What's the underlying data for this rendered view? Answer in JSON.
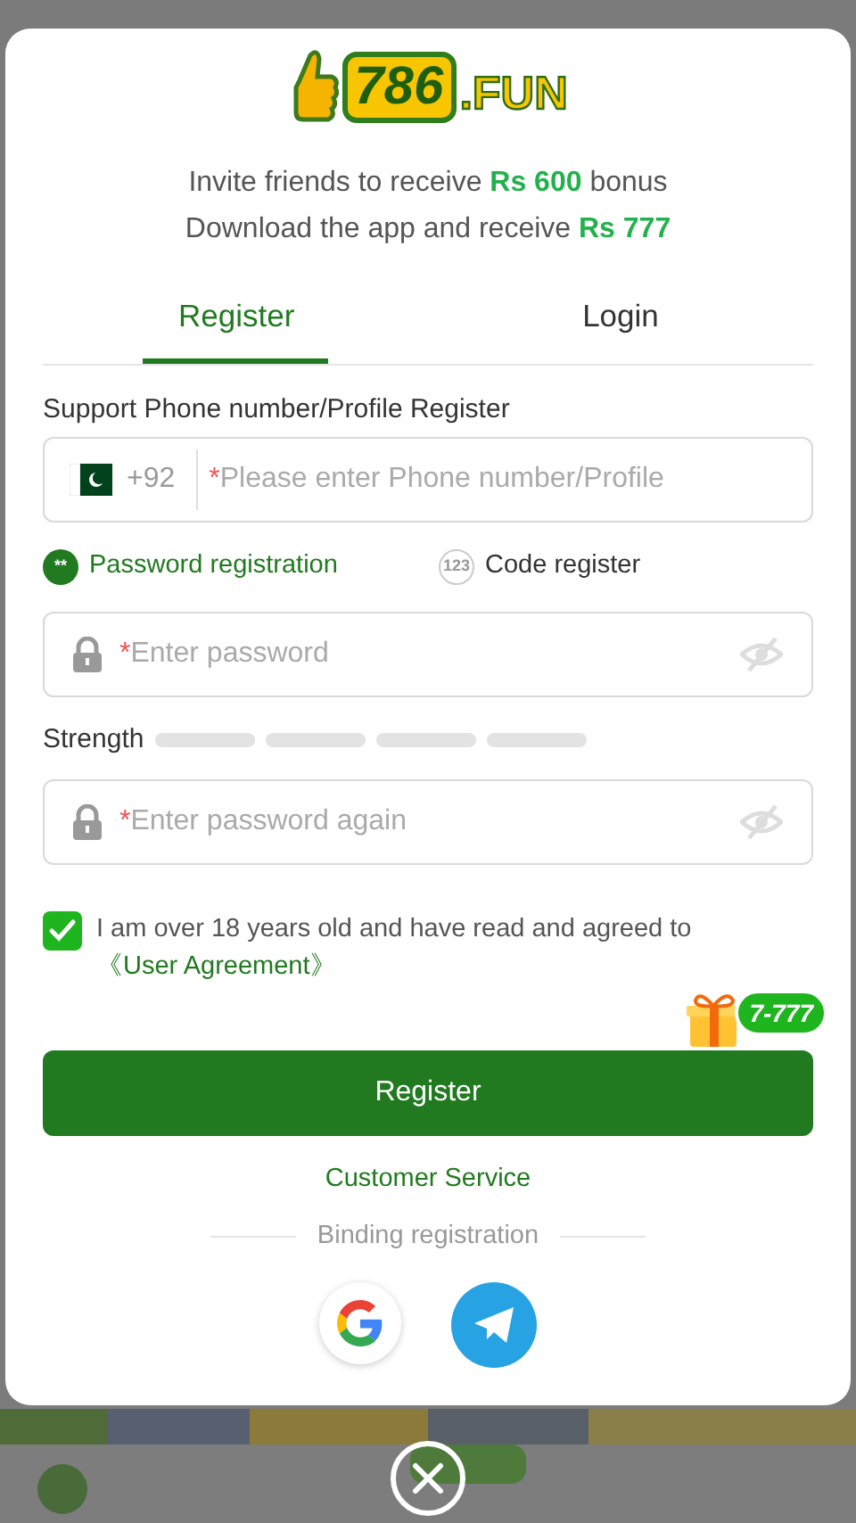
{
  "logo": {
    "number": "786",
    "suffix": ".FUN"
  },
  "promo_lines": [
    {
      "before": "Invite friends to receive ",
      "amount": "Rs 600",
      "after": " bonus"
    },
    {
      "before": "Download the app and receive ",
      "amount": "Rs 777"
    }
  ],
  "tabs": [
    {
      "label": "Register",
      "selected": true
    },
    {
      "label": "Login",
      "selected": false
    }
  ],
  "phone_section": {
    "label": "Support Phone number/Profile Register",
    "country_code": "+92",
    "required_mark": "*",
    "placeholder": "Please enter Phone number/Profile"
  },
  "methods": [
    {
      "badge": "**",
      "label": "Password registration",
      "selected": true
    },
    {
      "badge": "123",
      "label": "Code register",
      "selected": false
    }
  ],
  "password": {
    "required_mark": "*",
    "placeholder": "Enter password"
  },
  "strength": {
    "label": "Strength"
  },
  "password_again": {
    "required_mark": "*",
    "placeholder": "Enter password again"
  },
  "agreement": {
    "checked": true,
    "text": "I am over 18 years old and have read and agreed to ",
    "link": "《User Agreement》"
  },
  "gift_badge": "7-777",
  "register_button": "Register",
  "customer_service": "Customer Service",
  "binding_label": "Binding registration"
}
